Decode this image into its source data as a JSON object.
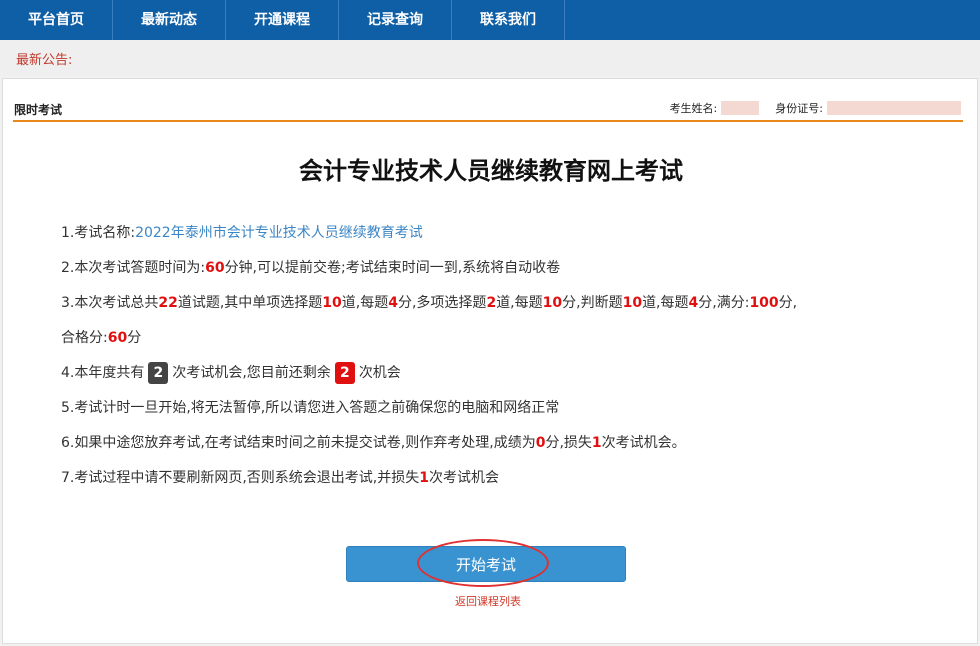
{
  "nav": [
    "平台首页",
    "最新动态",
    "开通课程",
    "记录查询",
    "联系我们"
  ],
  "notice": {
    "label": "最新公告:"
  },
  "panel": {
    "title": "限时考试",
    "name_label": "考生姓名:",
    "id_label": "身份证号:"
  },
  "exam_title": "会计专业技术人员继续教育网上考试",
  "rules": {
    "r1_prefix": "1.考试名称:",
    "r1_name": "2022年泰州市会计专业技术人员继续教育考试",
    "r2_a": "2.本次考试答题时间为:",
    "r2_minutes": "60",
    "r2_b": "分钟,可以提前交卷;考试结束时间一到,系统将自动收卷",
    "r3_a": "3.本次考试总共",
    "r3_total": "22",
    "r3_b": "道试题,其中单项选择题",
    "r3_single": "10",
    "r3_c": "道,每题",
    "r3_single_score": "4",
    "r3_d": "分,多项选择题",
    "r3_multi": "2",
    "r3_e": "道,每题",
    "r3_multi_score": "10",
    "r3_f": "分,判断题",
    "r3_judge": "10",
    "r3_g": "道,每题",
    "r3_judge_score": "4",
    "r3_h": "分,满分:",
    "r3_full": "100",
    "r3_i": "分,",
    "r3b_a": "合格分:",
    "r3b_pass": "60",
    "r3b_b": "分",
    "r4_a": "4.本年度共有",
    "r4_total": "2",
    "r4_b": "次考试机会,您目前还剩余",
    "r4_left": "2",
    "r4_c": "次机会",
    "r5": "5.考试计时一旦开始,将无法暂停,所以请您进入答题之前确保您的电脑和网络正常",
    "r6_a": "6.如果中途您放弃考试,在考试结束时间之前未提交试卷,则作弃考处理,成绩为",
    "r6_score": "0",
    "r6_b": "分,损失",
    "r6_lose": "1",
    "r6_c": "次考试机会。",
    "r7_a": "7.考试过程中请不要刷新网页,否则系统会退出考试,并损失",
    "r7_lose": "1",
    "r7_b": "次考试机会"
  },
  "start_button": "开始考试",
  "back_link": "返回课程列表",
  "colors": {
    "nav_bg": "#0f5fa6",
    "accent_orange": "#e88a1a",
    "highlight_red": "#e01010",
    "button_blue": "#3a93d1"
  }
}
